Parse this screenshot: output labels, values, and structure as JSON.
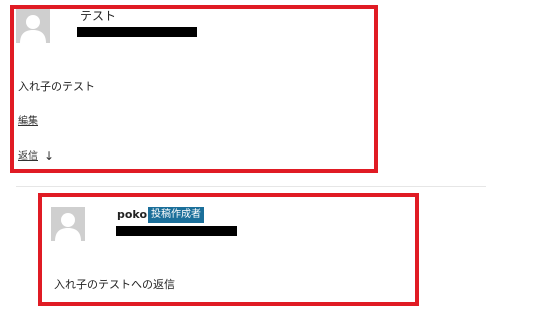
{
  "comments": [
    {
      "author": "テスト",
      "content": "入れ子のテスト",
      "edit_label": "編集",
      "reply_label": "返信",
      "reply_arrow": "↓"
    },
    {
      "author": "poko",
      "badge": "投稿作成者",
      "content": "入れ子のテストへの返信"
    }
  ],
  "colors": {
    "highlight_border": "#e01b24",
    "badge_bg": "#1b6f9a",
    "avatar_bg": "#cfcfcf"
  },
  "icons": {
    "avatar": "default-avatar-icon"
  }
}
